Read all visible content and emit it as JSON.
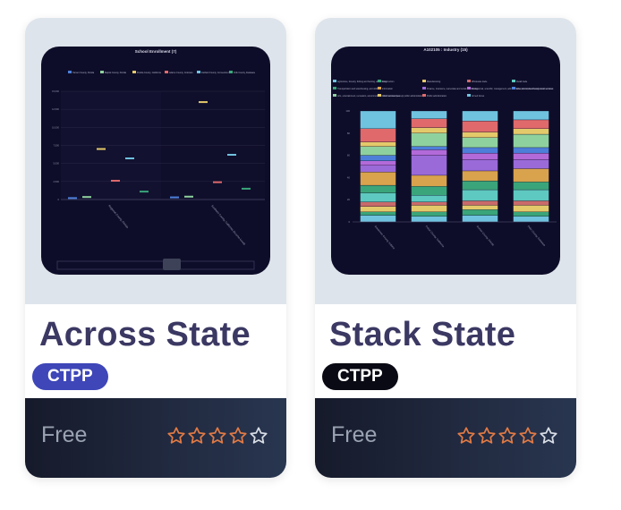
{
  "cards": [
    {
      "title": "Across State",
      "badge": "CTPP",
      "price": "Free",
      "rating": 4,
      "rating_max": 5,
      "badge_color": "#3e46b8",
      "thumbnail": {
        "chart_title": "School Enrollment (7)",
        "legend": [
          "Tarrant County, Florida",
          "Baptist County, Florida",
          "Florida County, California",
          "Adams County, Colorado",
          "Fairfield County, Connecticut",
          "Polk County, Delaware"
        ],
        "series_colors": [
          "#4d7fd9",
          "#8fd19e",
          "#e4c96a",
          "#e0696b",
          "#6fc3df",
          "#3aa57a"
        ],
        "categories": [
          "Regional County, Florida",
          "Southern County, California (Income-Level)"
        ],
        "y_ticks": [
          "0",
          "2,500",
          "5,000",
          "7,500",
          "10,000",
          "12,500",
          "15,000"
        ],
        "values": [
          [
            200,
            350,
            7000,
            2600,
            5700,
            1100
          ],
          [
            300,
            400,
            13500,
            2400,
            6200,
            1500
          ]
        ]
      }
    },
    {
      "title": "Stack State",
      "badge": "CTPP",
      "price": "Free",
      "rating": 4,
      "rating_max": 5,
      "badge_color": "#0a0a14",
      "thumbnail": {
        "chart_title": "A102105 : Industry (15)",
        "legend": [
          "Agriculture, forestry, fishing and hunting, and mining",
          "Construction",
          "Manufacturing",
          "Wholesale trade",
          "Retail trade",
          "Transportation and warehousing, and utilities",
          "Information",
          "Finance, insurance, real estate and rental and leasing",
          "Professional, scientific, management, administrative, and waste management services",
          "Educational, health and social services",
          "Arts, entertainment, recreation, accommodation and food services",
          "Other services (except public administration)",
          "Public administration",
          "Armed forces"
        ],
        "series_colors": [
          "#6fc3df",
          "#3aa57a",
          "#e4c96a",
          "#c96a6a",
          "#5ec9c0",
          "#3aa57a",
          "#d9a24d",
          "#9a6ad9",
          "#b36ad9",
          "#4d7fd9",
          "#8fd19e",
          "#e4c96a",
          "#e0696b",
          "#6fc3df"
        ],
        "categories": [
          "Suwannee County, Indiana",
          "Fulton County, California",
          "Sumter County, Florida",
          "Palm County, Delaware"
        ],
        "y_ticks": [
          "0",
          "20",
          "40",
          "60",
          "80",
          "100"
        ]
      }
    }
  ]
}
